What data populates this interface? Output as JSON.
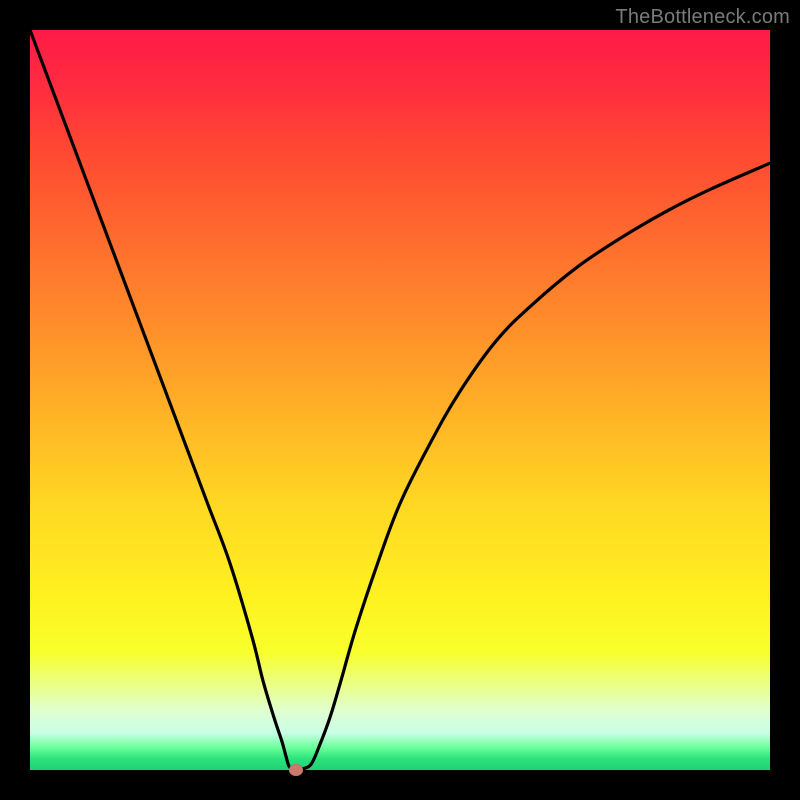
{
  "watermark": "TheBottleneck.com",
  "chart_data": {
    "type": "line",
    "title": "",
    "xlabel": "",
    "ylabel": "",
    "xlim": [
      0,
      100
    ],
    "ylim": [
      0,
      100
    ],
    "grid": false,
    "legend": false,
    "series": [
      {
        "name": "bottleneck-curve",
        "x": [
          0,
          3,
          6,
          9,
          12,
          15,
          18,
          21,
          24,
          27,
          30,
          31.5,
          33,
          34,
          34.5,
          35,
          35.5,
          36,
          36.5,
          37,
          38,
          39,
          40.5,
          42,
          44,
          47,
          50,
          54,
          58,
          63,
          68,
          74,
          80,
          86,
          92,
          100
        ],
        "y": [
          100,
          92,
          84,
          76,
          68,
          60,
          52,
          44,
          36,
          28,
          18,
          12,
          7,
          4,
          2.2,
          0.5,
          0.2,
          0.2,
          0.2,
          0.2,
          0.8,
          3,
          7,
          12,
          19,
          28,
          36,
          44,
          51,
          58,
          63,
          68,
          72,
          75.5,
          78.5,
          82
        ]
      }
    ],
    "annotations": [
      {
        "name": "optimal-point",
        "x": 36,
        "y": 0
      }
    ],
    "background_gradient": {
      "top": "#ff1a47",
      "mid": "#fff020",
      "bottom": "#21cf77"
    }
  }
}
